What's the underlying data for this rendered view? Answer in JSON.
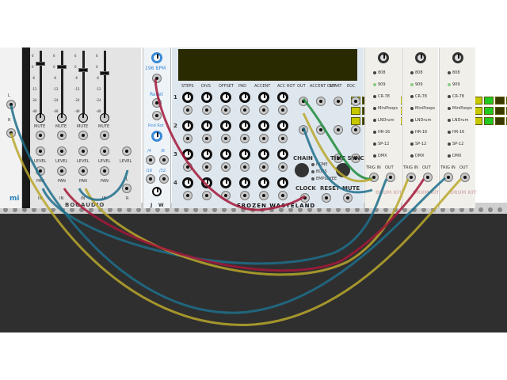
{
  "mixer": {
    "brand": "BOGAUDIO",
    "mute_label": "MUTE",
    "level_label": "LEVEL",
    "pan_label": "PAN",
    "in_label": "IN",
    "l_label": "L",
    "r_label": "R",
    "db_marks": [
      "6",
      "0",
      "-6",
      "-12",
      "-24",
      "-48"
    ]
  },
  "left_module": {
    "label": "mi",
    "jack_l": "L",
    "jack_r": "R"
  },
  "clock": {
    "bpm": "196 BPM",
    "reset_label": "Reset",
    "rnd_rot_label": "Rnd Rot",
    "ratio_labels": [
      "/4",
      "/8",
      "/16",
      "/32"
    ],
    "bottom_labels": [
      "J",
      "W"
    ]
  },
  "sequencer": {
    "brand": "FROZEN WASTELAND",
    "col_headers": [
      "STEPS",
      "DIVS",
      "OFFSET",
      "PAD",
      "ACCENT",
      "ACC ROT",
      "OUT",
      "ACCENT OUT",
      "START",
      "EOC"
    ],
    "row_numbers": [
      "1",
      "2",
      "3",
      "4"
    ],
    "chain_label": "CHAIN",
    "time_sync_label": "TIME SYNC",
    "chain_options": [
      "NONE",
      "BOSS",
      "EMPLOYEE"
    ],
    "clock_label": "CLOCK",
    "reset_label": "RESET",
    "mute_label": "MUTE"
  },
  "drumkits": [
    {
      "models": [
        "808",
        "909",
        "CR-78",
        "MiniPoops",
        "LNDrum",
        "HR-16",
        "SP-12",
        "DMX"
      ],
      "trig_label": "TRIG IN",
      "out_label": "OUT",
      "brand": "DRUM KIT"
    },
    {
      "models": [
        "808",
        "909",
        "CR-78",
        "MiniPoops",
        "LNDrum",
        "HR-16",
        "SP-12",
        "DMX"
      ],
      "trig_label": "TRIG IN",
      "out_label": "OUT",
      "brand": "DRUM KIT"
    },
    {
      "models": [
        "808",
        "909",
        "CR-78",
        "MiniPoops",
        "LNDrum",
        "HR-16",
        "SP-12",
        "DMX"
      ],
      "trig_label": "TRIG IN",
      "out_label": "OUT",
      "brand": "DRUM KIT"
    }
  ],
  "colors": {
    "cable_blue": "#1f6f8b",
    "cable_yellow": "#b9a72c",
    "cable_red": "#a3173a",
    "cable_green": "#1e8a3a",
    "grid_on": "#c8c800",
    "grid_green": "#22c822"
  }
}
